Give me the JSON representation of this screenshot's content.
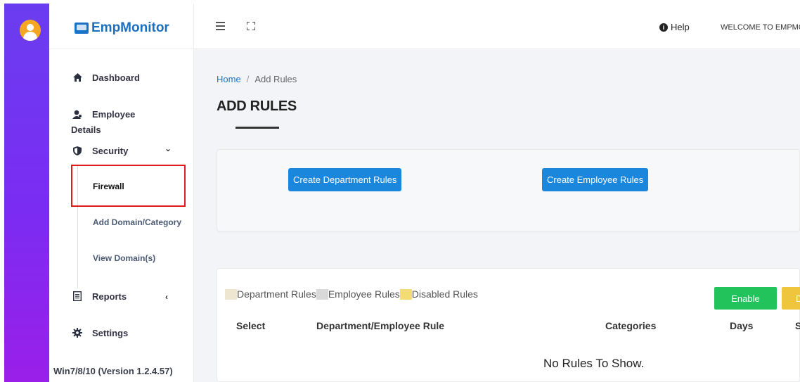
{
  "brand": {
    "name": "EmpMonitor"
  },
  "sidebar": {
    "items": [
      {
        "label": "Dashboard",
        "icon": "home-icon"
      },
      {
        "label": "Employee",
        "label2": "Details",
        "icon": "user-icon"
      },
      {
        "label": "Security",
        "icon": "shield-icon",
        "chevron": "⌄"
      },
      {
        "label": "Reports",
        "icon": "report-icon",
        "chevron": "‹"
      },
      {
        "label": "Settings",
        "icon": "gear-icon"
      }
    ],
    "security_subitems": [
      {
        "label": "Firewall",
        "active": true
      },
      {
        "label": "Add Domain/Category"
      },
      {
        "label": "View Domain(s)"
      }
    ],
    "version": "Win7/8/10 (Version 1.2.4.57)"
  },
  "topbar": {
    "help_label": "Help",
    "welcome_text": "WELCOME TO EMPMO"
  },
  "breadcrumb": {
    "home": "Home",
    "separator": "/",
    "current": "Add Rules"
  },
  "page_title": "ADD RULES",
  "actions": {
    "create_department_rules": "Create Department Rules",
    "create_employee_rules": "Create Employee Rules"
  },
  "legend": [
    {
      "label": "Department Rules",
      "color": "#efe6d2"
    },
    {
      "label": "Employee Rules",
      "color": "#d9d9d9"
    },
    {
      "label": "Disabled Rules",
      "color": "#f3dc74"
    }
  ],
  "table_buttons": {
    "enable": "Enable",
    "second": "D"
  },
  "table": {
    "headers": [
      "Select",
      "Department/Employee Rule",
      "Categories",
      "Days",
      "S"
    ],
    "empty_message": "No Rules To Show."
  },
  "colors": {
    "primary": "#1a86dc",
    "enable": "#21c35a",
    "warning": "#f0c53e",
    "sidebar_gradient_top": "#6a3df0",
    "sidebar_gradient_bottom": "#9a1fe8",
    "highlight": "#e01b1b"
  }
}
